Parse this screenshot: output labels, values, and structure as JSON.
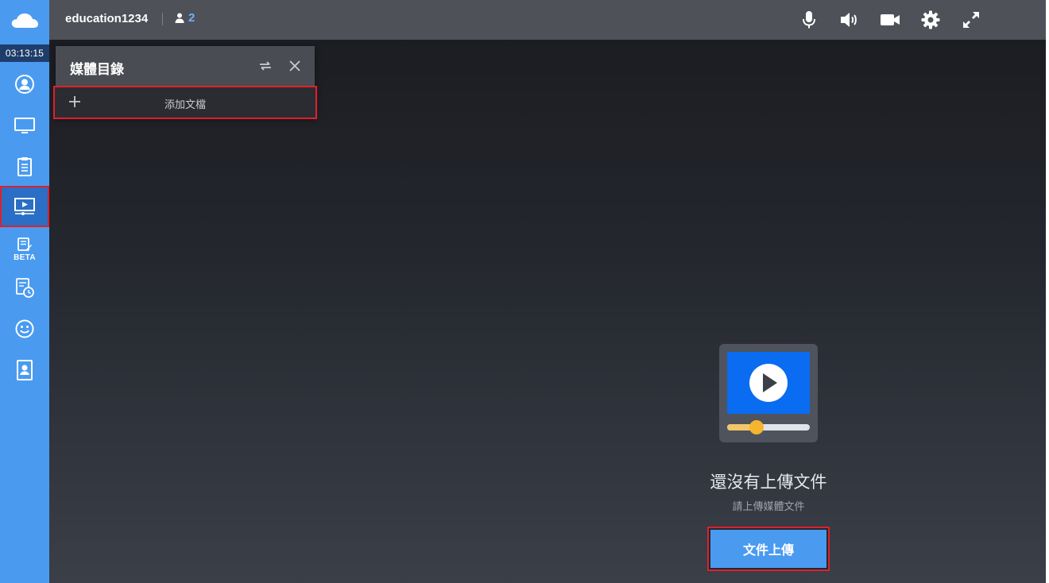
{
  "app": {
    "timer": "03:13:15"
  },
  "sidebar": {
    "items": [
      {
        "icon": "user-circle-icon"
      },
      {
        "icon": "monitor-icon"
      },
      {
        "icon": "clipboard-icon"
      },
      {
        "icon": "media-player-icon",
        "active": true
      },
      {
        "icon": "edit-note-icon",
        "badge": "BETA"
      },
      {
        "icon": "schedule-doc-icon"
      },
      {
        "icon": "smiley-icon"
      },
      {
        "icon": "contact-card-icon"
      }
    ]
  },
  "topbar": {
    "room_name": "education1234",
    "participant_count": "2",
    "icons": [
      "microphone-icon",
      "speaker-icon",
      "camera-icon",
      "settings-gear-icon",
      "fullscreen-icon"
    ]
  },
  "media_panel": {
    "title": "媒體目錄",
    "add_label": "添加文檔"
  },
  "empty_state": {
    "title": "還沒有上傳文件",
    "subtitle": "請上傳媒體文件",
    "upload_button": "文件上傳"
  },
  "colors": {
    "sidebar": "#4a9bf0",
    "sidebar_active": "#2a6fc5",
    "topbar": "#4f5159",
    "highlight_border": "#e0202a",
    "accent_blue": "#0a6cf0",
    "slider_knob": "#f5b52e"
  }
}
